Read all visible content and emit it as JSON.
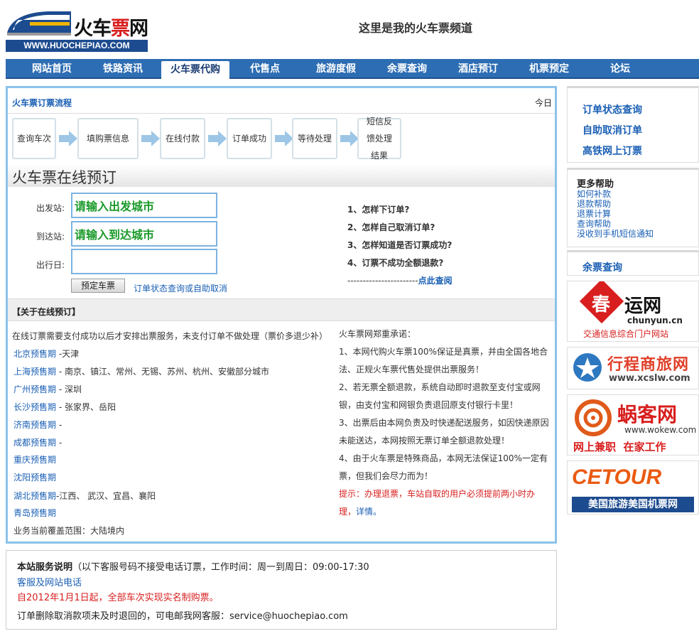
{
  "logo": {
    "brand_prefix": "火车",
    "brand_red": "票",
    "brand_suffix": "网",
    "url": "WWW.HUOCHEPIAO.COM"
  },
  "slogan": "这里是我的火车票频道",
  "nav": [
    {
      "label": "网站首页"
    },
    {
      "label": "铁路资讯"
    },
    {
      "label": "火车票代购"
    },
    {
      "label": "代售点"
    },
    {
      "label": "旅游度假"
    },
    {
      "label": "余票查询"
    },
    {
      "label": "酒店预订"
    },
    {
      "label": "机票预定"
    },
    {
      "label": "论坛"
    }
  ],
  "flow": {
    "title": "火车票订票流程",
    "today": "今日",
    "steps": [
      "查询车次",
      "填购票信息",
      "在线付款",
      "订单成功",
      "等待处理",
      "短信反馈处理结果"
    ]
  },
  "booking": {
    "title": "火车票在线预订",
    "from_label": "出发站:",
    "from_placeholder": "请输入出发城市",
    "to_label": "到达站:",
    "to_placeholder": "请输入到达城市",
    "date_label": "出行日:",
    "date_value": "",
    "book_button": "预定车票",
    "status_link": "订单状态查询或自助取消"
  },
  "faq": {
    "items": [
      "1、怎样下订单?",
      "2、怎样自己取消订单?",
      "3、怎样知道是否订票成功?",
      "4、订票不成功全额退款?"
    ],
    "more_prefix": "-----------------------",
    "more_link": "点此查阅"
  },
  "about": {
    "title": "【关于在线预订】",
    "intro": "在线订票需要支付成功以后才安排出票服务，未支付订单不做处理（票价多退少补）",
    "regions": [
      {
        "name": "北京预售期",
        "cities": " -天津"
      },
      {
        "name": "上海预售期",
        "cities": " - 南京、镇江、常州、无锡、苏州、杭州、安徽部分城市"
      },
      {
        "name": "广州预售期",
        "cities": " - 深圳"
      },
      {
        "name": "长沙预售期",
        "cities": " - 张家界、岳阳"
      },
      {
        "name": "济南预售期",
        "cities": " -"
      },
      {
        "name": "成都预售期",
        "cities": " -"
      },
      {
        "name": "重庆预售期",
        "cities": ""
      },
      {
        "name": "沈阳预售期",
        "cities": ""
      },
      {
        "name": "湖北预售期",
        "cities": "-江西、 武汉、宜昌、襄阳"
      },
      {
        "name": "青岛预售期",
        "cities": ""
      }
    ],
    "coverage": "业务当前覆盖范围：大陆境内",
    "promise_title": "火车票网郑重承诺：",
    "promises": [
      "1、本网代购火车票100%保证是真票，并由全国各地合法、正规火车票代售处提供出票服务！",
      "2、若无票全额退款，系统自动即时退款至支付宝或网银，由支付宝和网银负责退回原支付银行卡里！",
      "3、出票后由本网负责及时快递配送服务，如因快递原因未能送达，本网按照无票订单全额退款处理！",
      "4、由于火车票是特殊商品，本网无法保证100%一定有票，但我们会尽力而为！"
    ],
    "tip": "提示：办理退票，车站自取的用户必须提前两小时办理，",
    "tip_link": "详情。"
  },
  "service": {
    "title": "本站服务说明",
    "hours": "（以下客服号码不接受电话订票，工作时间：周一到周日：09:00-17:30",
    "phone_link": "客服及网站电话",
    "notice": "自2012年1月1日起，全部车次实现实名制购票。",
    "email_line": "订单删除取消款项未及时退回的，可电邮我网客服：service@huochepiao.com"
  },
  "sidebar": {
    "links": [
      "订单状态查询",
      "自助取消订单",
      "高铁网上订票"
    ],
    "help_title": "更多帮助",
    "help_links": [
      "如何补款",
      "退款帮助",
      "退票计算",
      "查询帮助",
      "没收到手机短信通知"
    ],
    "ticket_query": "余票查询",
    "banners": [
      {
        "name_big": "春",
        "name_rest": "运网",
        "domain": "chunyun.cn",
        "caption": "交通信息综合门户网站"
      },
      {
        "name": "行程商旅网",
        "domain": "www.xcslw.com"
      },
      {
        "name": "蜗客网",
        "domain": "www.wokew.com",
        "caption": "网上兼职  在家工作"
      },
      {
        "name": "CETOUR",
        "caption": "美国旅游美国机票网"
      }
    ]
  },
  "colors": {
    "nav_bg": "#2d6db3",
    "link": "#1a5fb4",
    "accent_red": "#d81e1e",
    "input_text": "#1a9a2a"
  }
}
